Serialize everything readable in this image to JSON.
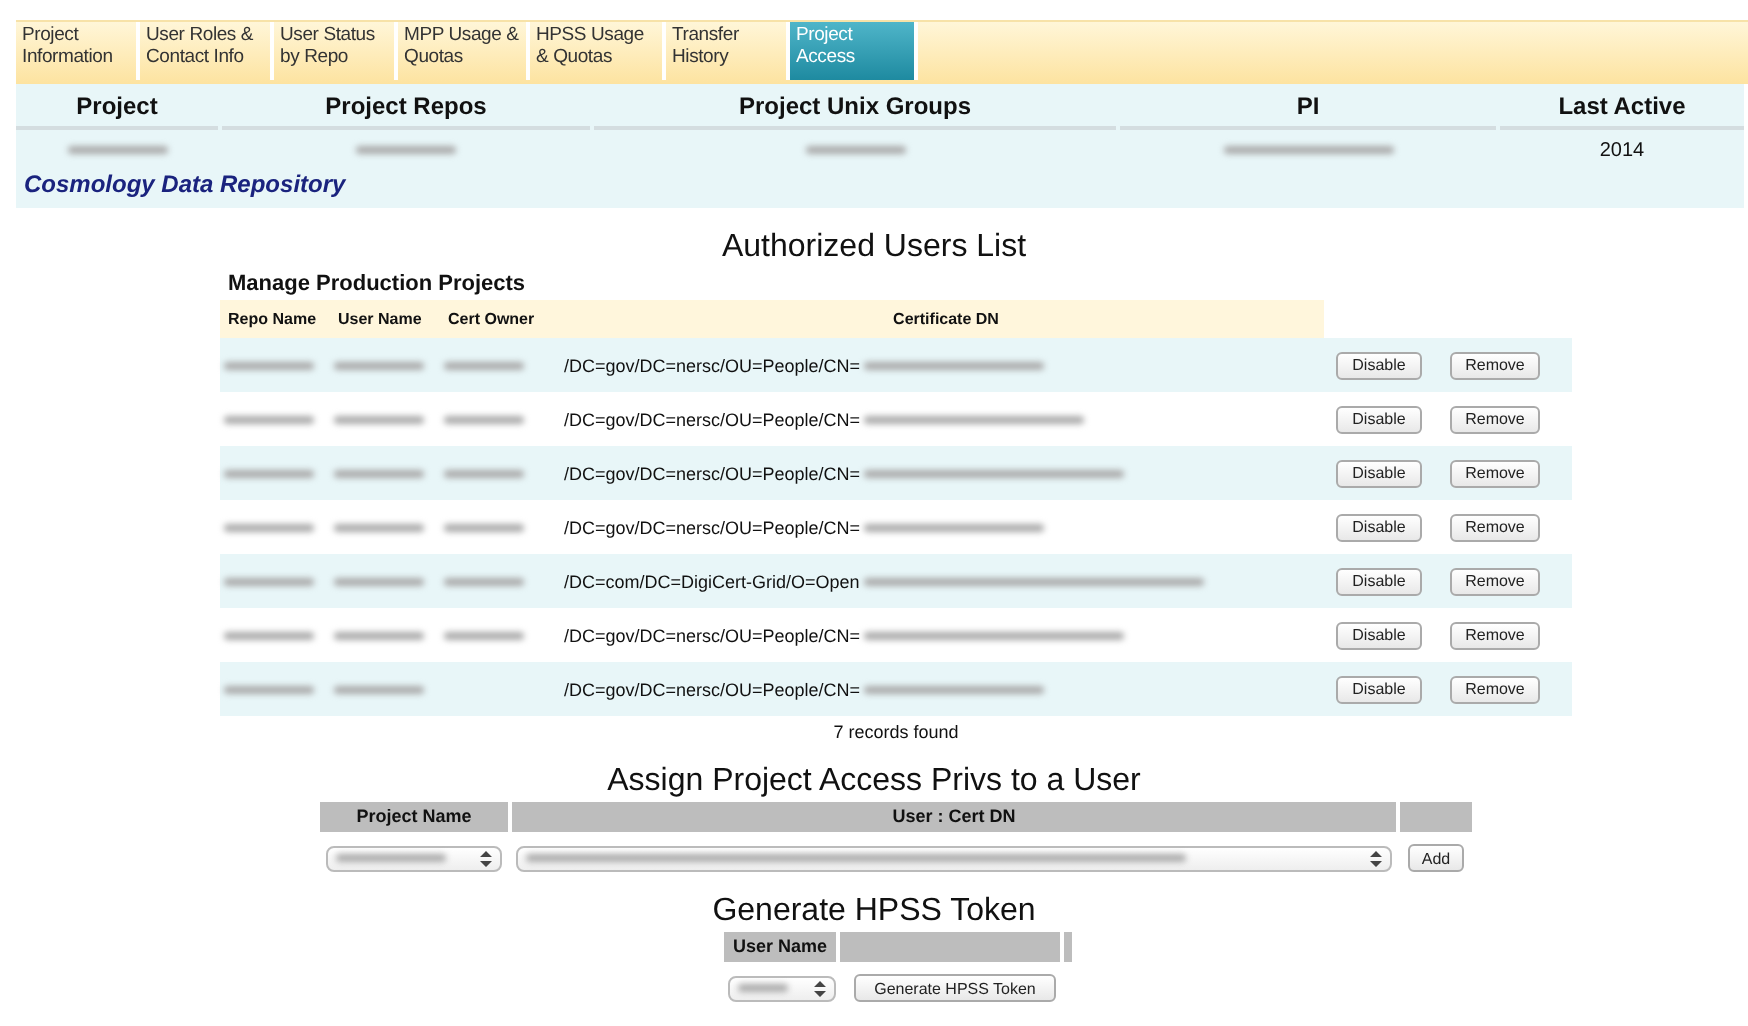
{
  "tabs": [
    {
      "label": "Project Information",
      "selected": false
    },
    {
      "label": "User Roles & Contact Info",
      "selected": false
    },
    {
      "label": "User Status by Repo",
      "selected": false
    },
    {
      "label": "MPP Usage & Quotas",
      "selected": false
    },
    {
      "label": "HPSS Usage & Quotas",
      "selected": false
    },
    {
      "label": "Transfer History",
      "selected": false
    },
    {
      "label": "Project Access",
      "selected": true
    }
  ],
  "project_summary": {
    "columns": [
      "Project",
      "Project Repos",
      "Project Unix Groups",
      "PI",
      "Last Active"
    ],
    "last_active": "2014",
    "description": "Cosmology Data Repository"
  },
  "authorized_users": {
    "title": "Authorized Users List",
    "subtitle": "Manage Production Projects",
    "columns": [
      "Repo Name",
      "User Name",
      "Cert Owner",
      "Certificate DN"
    ],
    "rows": [
      {
        "dn": "/DC=gov/DC=nersc/OU=People/CN=",
        "disable": "Disable",
        "remove": "Remove"
      },
      {
        "dn": "/DC=gov/DC=nersc/OU=People/CN=",
        "disable": "Disable",
        "remove": "Remove"
      },
      {
        "dn": "/DC=gov/DC=nersc/OU=People/CN=",
        "disable": "Disable",
        "remove": "Remove"
      },
      {
        "dn": "/DC=gov/DC=nersc/OU=People/CN=",
        "disable": "Disable",
        "remove": "Remove"
      },
      {
        "dn": "/DC=com/DC=DigiCert-Grid/O=Open",
        "disable": "Disable",
        "remove": "Remove"
      },
      {
        "dn": "/DC=gov/DC=nersc/OU=People/CN=",
        "disable": "Disable",
        "remove": "Remove"
      },
      {
        "dn": "/DC=gov/DC=nersc/OU=People/CN=",
        "disable": "Disable",
        "remove": "Remove"
      }
    ],
    "record_count": "7 records found"
  },
  "assign": {
    "title": "Assign Project Access Privs to a User",
    "columns": [
      "Project Name",
      "User : Cert DN"
    ],
    "add_button": "Add"
  },
  "hpss_token": {
    "title": "Generate HPSS Token",
    "columns": [
      "User Name"
    ],
    "button": "Generate HPSS Token"
  }
}
